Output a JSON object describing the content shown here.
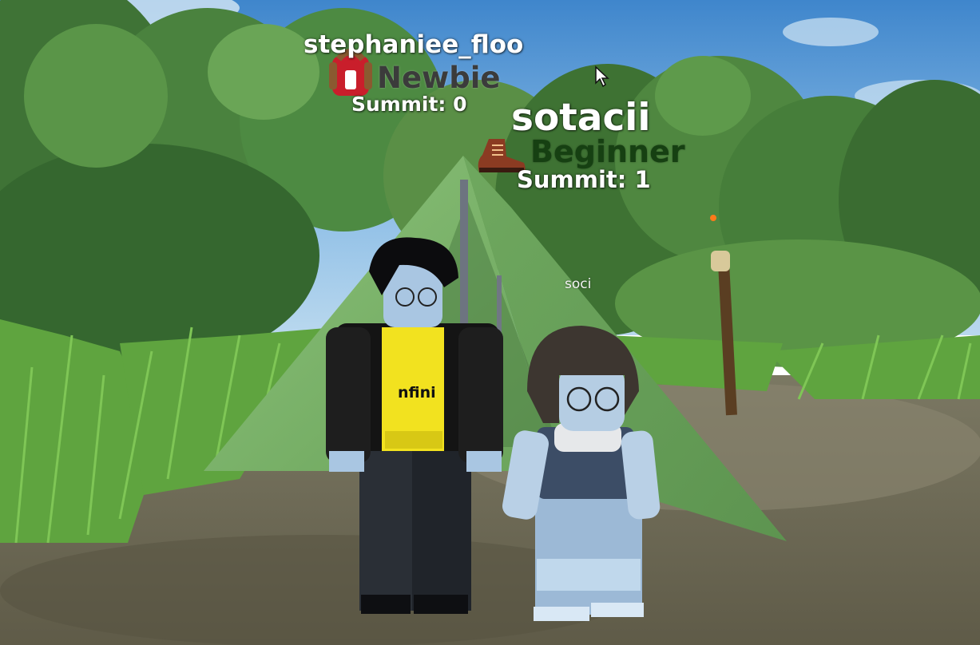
{
  "players": [
    {
      "username": "stephaniee_floo",
      "rank": "Newbie",
      "rank_icon": "backpack-icon",
      "summit_text": "Summit: 0"
    },
    {
      "username": "sotacii",
      "rank": "Beginner",
      "rank_icon": "hiking-boot-icon",
      "summit_text": "Summit: 1"
    }
  ],
  "overhead_label": "soci",
  "shirt_text": "nfini",
  "colors": {
    "sky": "#4a8fcf",
    "tent": "#7fb36a",
    "ground": "#6f6a54",
    "rank_newbie": "#3b3b3b",
    "rank_beginner": "#164012"
  }
}
